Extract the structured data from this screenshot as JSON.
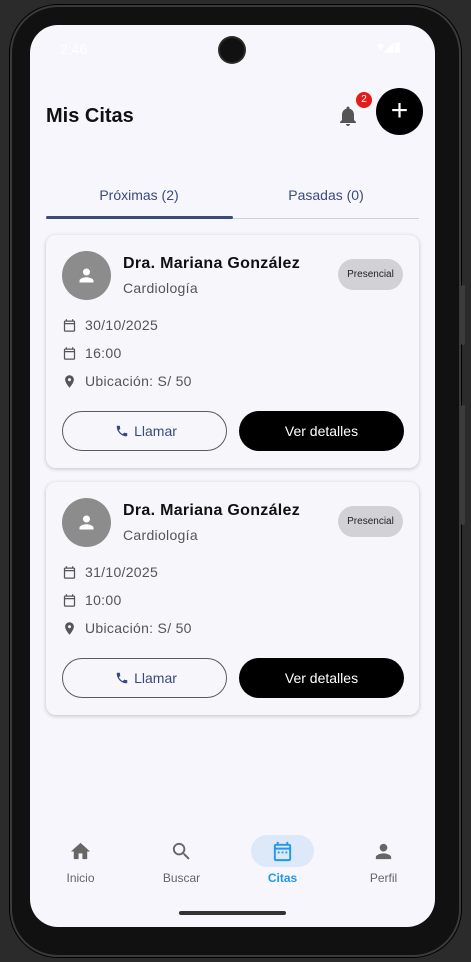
{
  "status": {
    "time": "2:46",
    "icons": "▾◢▮"
  },
  "header": {
    "title": "Mis Citas",
    "notification_count": "2",
    "add_label": "+"
  },
  "tabs": [
    {
      "label": "Próximas (2)",
      "active": true
    },
    {
      "label": "Pasadas (0)",
      "active": false
    }
  ],
  "appointments": [
    {
      "doctor": "Dra. Mariana González",
      "specialty": "Cardiología",
      "mode": "Presencial",
      "date": "30/10/2025",
      "time": "16:00",
      "location": "Ubicación: S/ 50",
      "call_label": "Llamar",
      "details_label": "Ver detalles"
    },
    {
      "doctor": "Dra. Mariana González",
      "specialty": "Cardiología",
      "mode": "Presencial",
      "date": "31/10/2025",
      "time": "10:00",
      "location": "Ubicación: S/ 50",
      "call_label": "Llamar",
      "details_label": "Ver detalles"
    }
  ],
  "nav": [
    {
      "label": "Inicio",
      "icon": "home-icon"
    },
    {
      "label": "Buscar",
      "icon": "search-icon"
    },
    {
      "label": "Citas",
      "icon": "calendar-icon",
      "selected": true
    },
    {
      "label": "Perfil",
      "icon": "person-icon"
    }
  ],
  "colors": {
    "accent": "#3a4a7c",
    "nav_selected": "#2196f3",
    "badge": "#e31b1b"
  }
}
